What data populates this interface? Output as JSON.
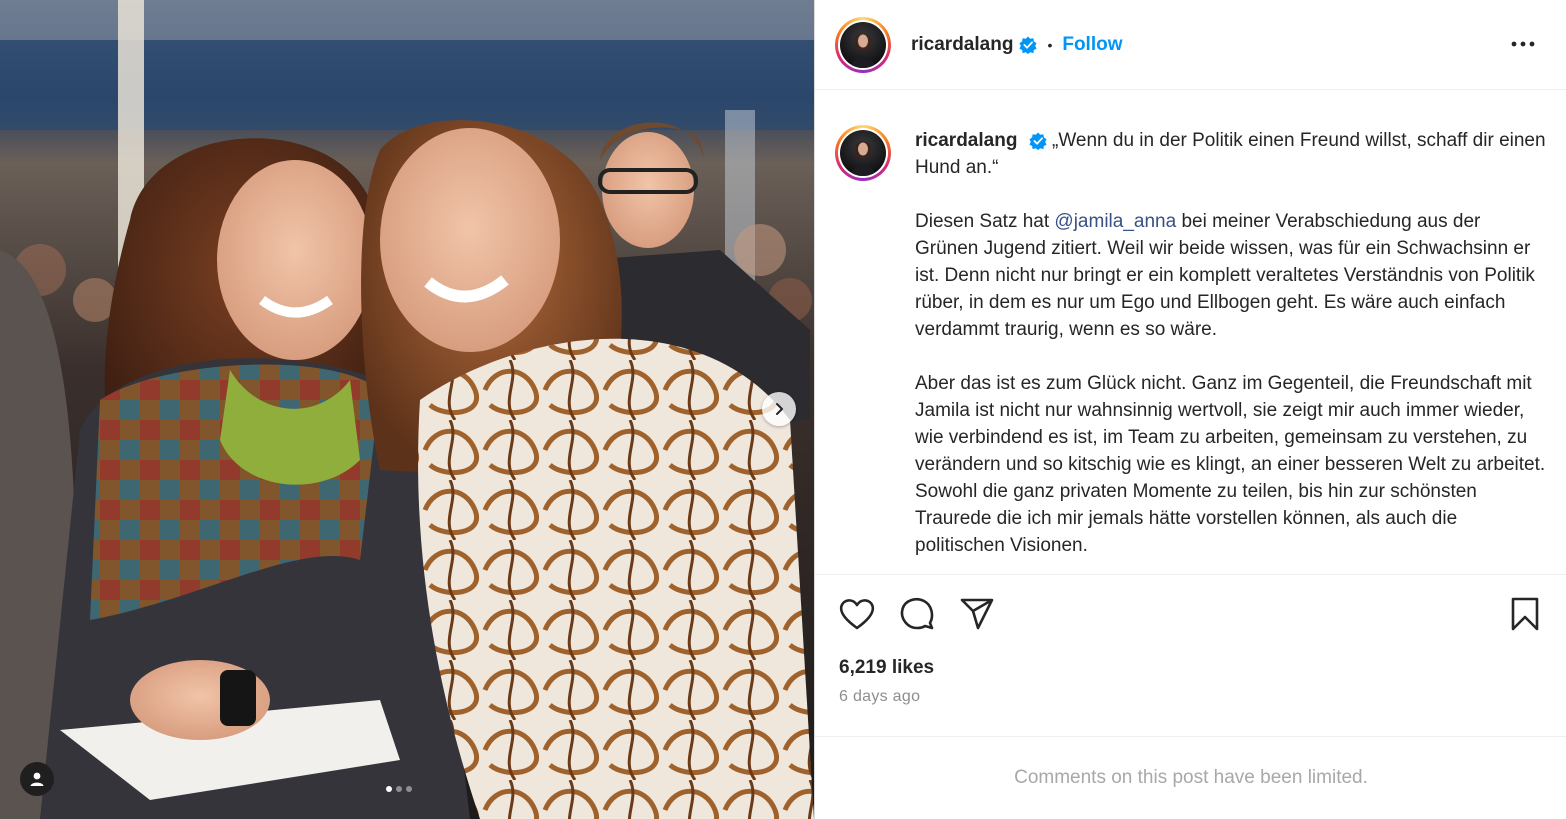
{
  "post": {
    "username": "ricardalang",
    "bullet": "•",
    "follow_label": "Follow",
    "caption": {
      "username": "ricardalang",
      "paragraph_1": "„Wenn du in der Politik einen Freund willst, schaff dir einen Hund an.“",
      "paragraph_2_before": "Diesen Satz hat ",
      "mention": "@jamila_anna",
      "paragraph_2_after": " bei meiner Verabschiedung aus der Grünen Jugend zitiert. Weil wir beide wissen, was für ein Schwachsinn er ist. Denn nicht nur bringt er ein komplett veraltetes Verständnis von Politik rüber, in dem es nur um Ego und Ellbogen geht. Es wäre auch einfach verdammt traurig, wenn es so wäre.",
      "paragraph_3": "Aber das ist es zum Glück nicht. Ganz im Gegenteil, die Freundschaft mit Jamila ist nicht nur wahnsinnig wertvoll, sie zeigt mir auch immer wieder, wie verbindend es ist, im Team zu arbeiten, gemeinsam zu verstehen, zu verändern und so kitschig wie es klingt, an einer besseren Welt zu arbeitet. Sowohl die ganz privaten Momente zu teilen, bis hin zur schönsten Traurede die ich mir jemals hätte vorstellen können, als auch die politischen Visionen."
    },
    "likes": "6,219 likes",
    "timestamp": "6 days ago",
    "comments_notice": "Comments on this post have been limited.",
    "carousel": {
      "slides": 3,
      "active": 1
    }
  },
  "icons": {
    "verified": "verified-badge-icon",
    "more": "more-options-icon",
    "like": "heart-icon",
    "comment": "comment-icon",
    "share": "send-icon",
    "save": "bookmark-icon",
    "next": "chevron-right-icon",
    "tags": "user-tag-icon"
  },
  "colors": {
    "accent": "#0095f6",
    "mention": "#385185",
    "verified": "#0095f6",
    "secondary_text": "#8e8e8e"
  }
}
